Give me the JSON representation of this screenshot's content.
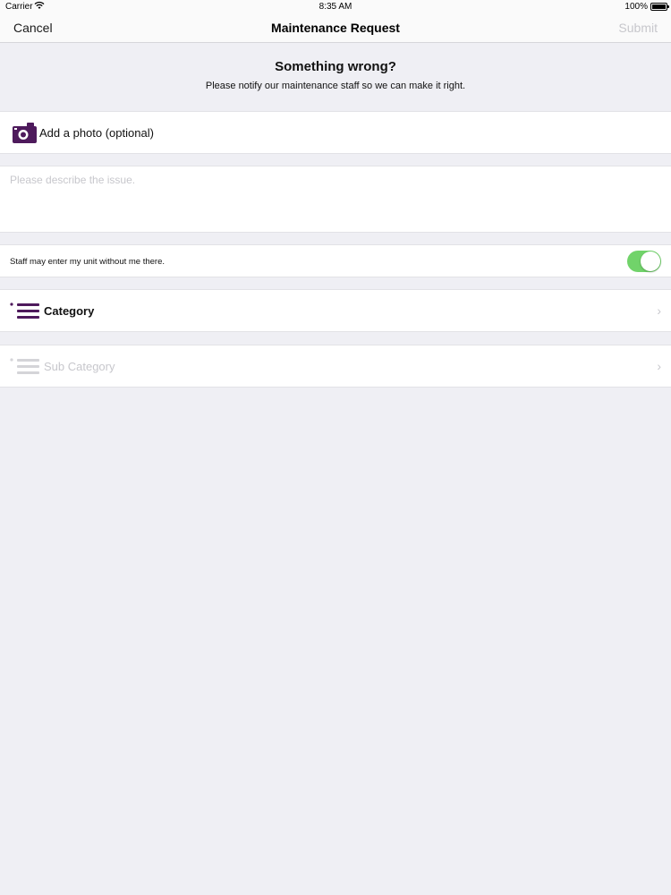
{
  "status_bar": {
    "carrier": "Carrier",
    "time": "8:35 AM",
    "battery": "100%"
  },
  "nav": {
    "cancel_label": "Cancel",
    "title": "Maintenance Request",
    "submit_label": "Submit"
  },
  "header": {
    "title": "Something wrong?",
    "subtitle": "Please notify our maintenance staff so we can make it right."
  },
  "photo": {
    "label": "Add a photo (optional)",
    "icon": "camera-icon"
  },
  "description": {
    "placeholder": "Please describe the issue.",
    "value": ""
  },
  "entry_permission": {
    "label": "Staff may enter my unit without me there.",
    "enabled": true
  },
  "category": {
    "label": "Category",
    "icon": "list-icon"
  },
  "sub_category": {
    "label": "Sub Category",
    "icon": "list-icon"
  },
  "colors": {
    "accent": "#4e1a5c",
    "toggle_on": "#71d36a",
    "disabled": "#c7c7cc",
    "background": "#efeff4"
  }
}
